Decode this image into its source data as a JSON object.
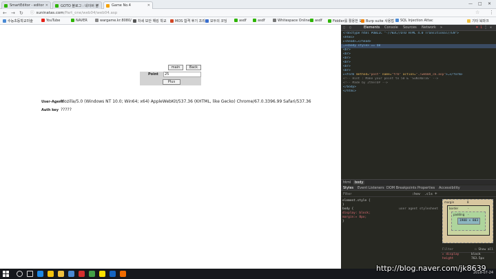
{
  "browser": {
    "tabs": [
      {
        "label": "SmartEditor - editor",
        "color": "#2db400"
      },
      {
        "label": "GOTO 블로그 : 네이버 블",
        "color": "#2db400"
      },
      {
        "label": "Game No.4",
        "color": "#f4a100"
      }
    ],
    "window_controls": [
      "—",
      "□",
      "✕"
    ],
    "nav": {
      "back": "←",
      "forward": "→",
      "reload": "↻"
    },
    "address": {
      "host": "suninatas.com",
      "path": "/Part_one/web04/web04.asp"
    },
    "bookmarks": [
      {
        "label": "수능초등학교미술",
        "color": "#4a8ad4"
      },
      {
        "label": "YouTube",
        "color": "#e62117"
      },
      {
        "label": "NAVER",
        "color": "#2db400"
      },
      {
        "label": "wargame.kr:8080/",
        "color": "#888888"
      },
      {
        "label": "차세 보안 해킹 학교",
        "color": "#555555"
      },
      {
        "label": "MOS 합격 후기 조리...",
        "color": "#d24726"
      },
      {
        "label": "모두의 코딩",
        "color": "#3b6fcf"
      },
      {
        "label": "asdf",
        "color": "#2db400"
      },
      {
        "label": "asdf",
        "color": "#2db400"
      },
      {
        "label": "Whitespace Online",
        "color": "#777777"
      },
      {
        "label": "asdf",
        "color": "#2db400"
      },
      {
        "label": "Fiddler를 활용한 보",
        "color": "#2db400"
      },
      {
        "label": "Burp suite 사용법",
        "color": "#f08000"
      },
      {
        "label": "SQL Injection Attac",
        "color": "#4a8ad4"
      },
      {
        "label": "기타 북마크",
        "color": "#f0c040"
      }
    ]
  },
  "game": {
    "main_button": "main",
    "back_button": "Back",
    "point_label": "Point",
    "point_value": "25",
    "plus_button": "Plus",
    "ua_label": "User-Agent",
    "ua_value": "Mozilla/5.0 (Windows NT 10.0; Win64; x64) AppleWebKit/537.36 (KHTML, like Gecko) Chrome/67.0.3396.99 Safari/537.36",
    "auth_label": "Auth key",
    "auth_value": "?????"
  },
  "devtools": {
    "tabs": [
      "Elements",
      "Console",
      "Sources",
      "Network"
    ],
    "more": "»",
    "error_count": "✖ 1",
    "controls": [
      "⋮",
      "✕"
    ],
    "code_lines": [
      {
        "parts": [
          {
            "c": "tag",
            "t": "<!doctype html PUBLIC \"-//W3C//DTD HTML 4.0 Transitional//EN\">"
          }
        ]
      },
      {
        "parts": [
          {
            "c": "tag",
            "t": "<html>"
          }
        ]
      },
      {
        "parts": [
          {
            "c": "tag",
            "t": " ▸<head>…</head>"
          }
        ]
      },
      {
        "sel": true,
        "parts": [
          {
            "c": "tag",
            "t": "…▾<body style> == $0"
          }
        ]
      },
      {
        "parts": [
          {
            "c": "tag",
            "t": "      <br>"
          }
        ]
      },
      {
        "parts": [
          {
            "c": "tag",
            "t": "      <br>"
          }
        ]
      },
      {
        "parts": [
          {
            "c": "tag",
            "t": "      <br>"
          }
        ]
      },
      {
        "parts": [
          {
            "c": "tag",
            "t": "      <br>"
          }
        ]
      },
      {
        "parts": [
          {
            "c": "tag",
            "t": "      <br>"
          }
        ]
      },
      {
        "parts": [
          {
            "c": "tag",
            "t": "      <br>"
          }
        ]
      },
      {
        "parts": [
          {
            "c": "tag",
            "t": "   ▸<form "
          },
          {
            "c": "attr",
            "t": "method="
          },
          {
            "c": "aval",
            "t": "\"post\" "
          },
          {
            "c": "attr",
            "t": "name="
          },
          {
            "c": "aval",
            "t": "\"frm\" "
          },
          {
            "c": "attr",
            "t": "action="
          },
          {
            "c": "aval",
            "t": "\"./web04_ck.asp\""
          },
          {
            "c": "tag",
            "t": ">…</form>"
          }
        ]
      },
      {
        "parts": [
          {
            "c": "cmt",
            "t": "      <!-- Hint : Make your point to 50 & 'SuNiNaTaS' -->"
          }
        ]
      },
      {
        "parts": [
          {
            "c": "cmt",
            "t": "      <!-- Made by 2theTOP -->"
          }
        ]
      },
      {
        "parts": [
          {
            "c": "tag",
            "t": "    </body>"
          }
        ]
      },
      {
        "parts": [
          {
            "c": "tag",
            "t": "</html>"
          }
        ]
      }
    ],
    "crumbs": [
      "html",
      "body"
    ],
    "subtabs": [
      "Styles",
      "Event Listeners",
      "DOM Breakpoints",
      "Properties",
      "Accessibility"
    ],
    "filter_placeholder": "Filter",
    "hov": ":hov",
    "cls": ".cls",
    "add": "+",
    "rules": [
      {
        "text": "element.style {",
        "src": ""
      },
      {
        "text": "}",
        "src": ""
      },
      {
        "text": "body {",
        "src": "user agent stylesheet"
      },
      {
        "text": "  display: block;",
        "src": ""
      },
      {
        "text": "  margin:▸ 8px;",
        "src": ""
      },
      {
        "text": "}",
        "src": ""
      }
    ],
    "box": {
      "margin": "margin",
      "margin_val": "8",
      "border": "border",
      "border_val": "-",
      "padding": "padding",
      "padding_val": "-",
      "content": "1900 × 803"
    },
    "computed_filter": "Filter",
    "show_all": "Show all",
    "computed": [
      {
        "prop": "▸ display",
        "val": "block"
      },
      {
        "prop": "  height",
        "val": "763.5px"
      }
    ]
  },
  "taskbar": {
    "icons": [
      {
        "name": "search-icon",
        "color": "#dddddd"
      },
      {
        "name": "task-view-icon",
        "color": "#dddddd"
      },
      {
        "name": "edge-icon",
        "color": "#1e88e5"
      },
      {
        "name": "chrome-icon",
        "color": "#f4c20d"
      },
      {
        "name": "explorer-icon",
        "color": "#f0c040"
      },
      {
        "name": "store-icon",
        "color": "#4a8ad4"
      },
      {
        "name": "app-red-icon",
        "color": "#d32f2f"
      },
      {
        "name": "app-green-icon",
        "color": "#43a047"
      },
      {
        "name": "kakao-icon",
        "color": "#fae100"
      },
      {
        "name": "app-blue-icon",
        "color": "#1565c0"
      },
      {
        "name": "app-orange-icon",
        "color": "#ef6c00"
      }
    ],
    "date": "2018-07-24"
  },
  "watermark": "http://blog.naver.com/jk8639"
}
